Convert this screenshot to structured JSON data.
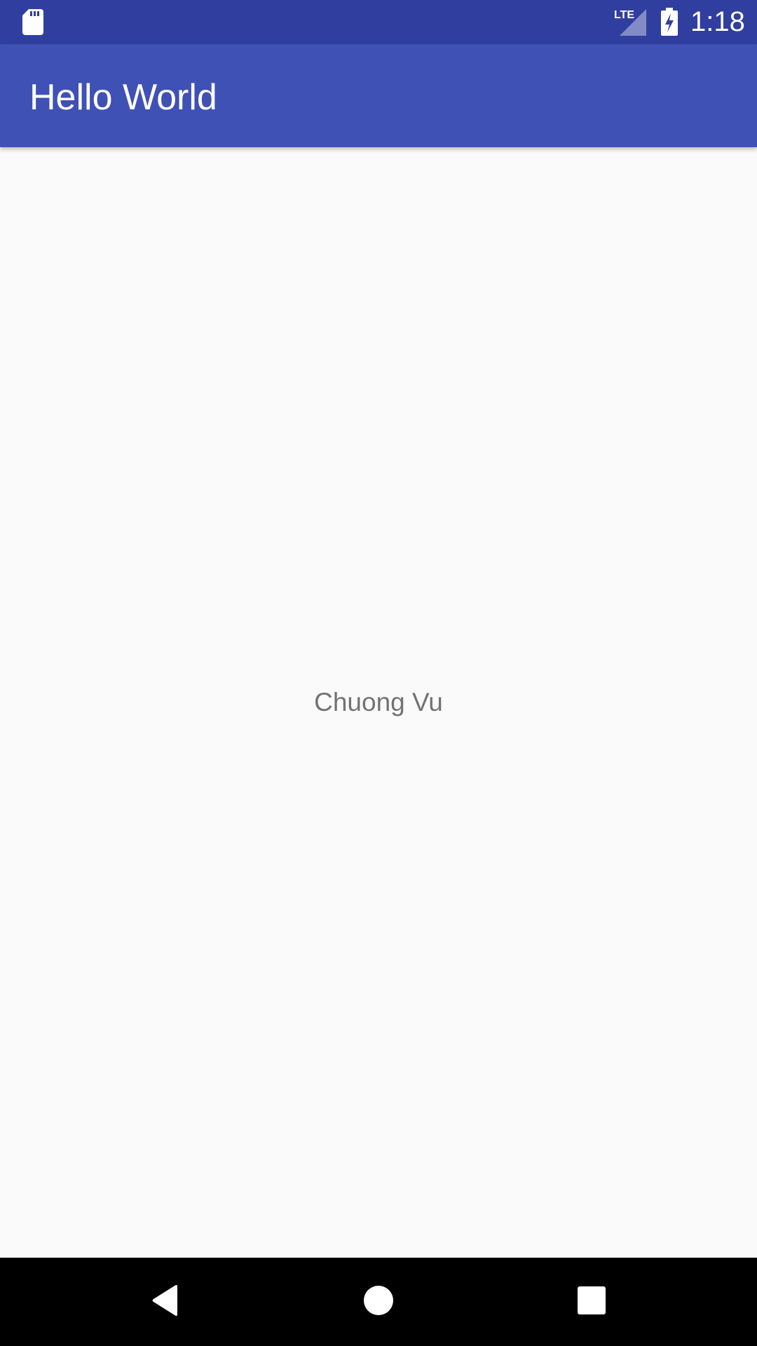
{
  "status_bar": {
    "network_label": "LTE",
    "time": "1:18",
    "icons": [
      "sd-card-icon",
      "lte-signal-icon",
      "battery-charging-icon"
    ]
  },
  "app_bar": {
    "title": "Hello World",
    "color": "#3f51b5",
    "status_color": "#303f9f"
  },
  "content": {
    "text": "Chuong Vu"
  },
  "nav_bar": {
    "icons": [
      "back-icon",
      "home-icon",
      "recents-icon"
    ]
  }
}
